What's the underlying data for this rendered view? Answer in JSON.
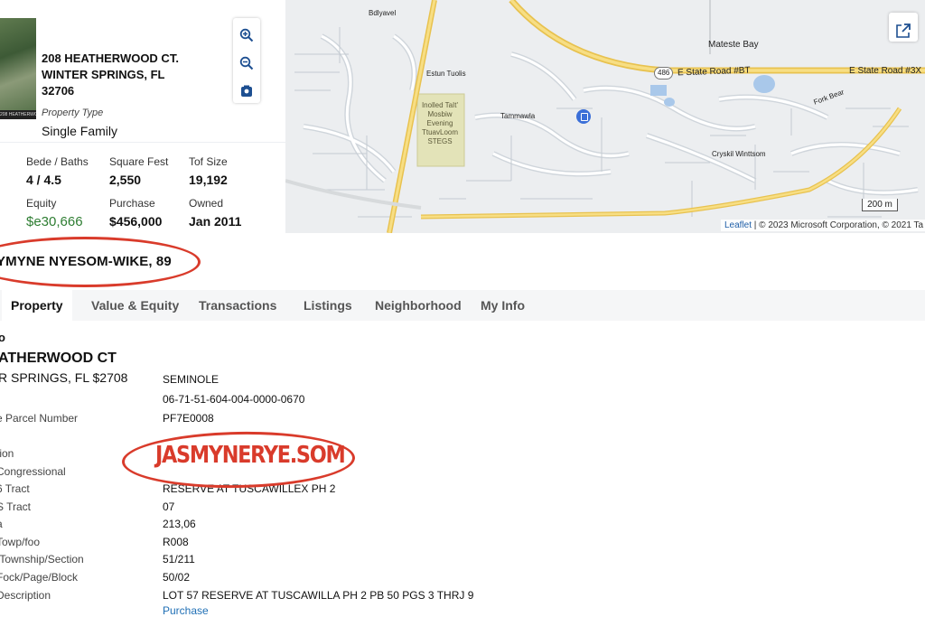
{
  "summary": {
    "thumb_strip_text": "208 HEATHERWOOD",
    "address_line1": "208 HEATHERWOOD CT.",
    "address_line2": "WINTER SPRINGS, FL",
    "address_line3": "32706",
    "property_type_label": "Property Type",
    "property_type_value": "Single Family",
    "stats": [
      {
        "label": "Bede / Baths",
        "value": "4 / 4.5"
      },
      {
        "label": "Square Fest",
        "value": "2,550"
      },
      {
        "label": "Tof Size",
        "value": "19,192"
      },
      {
        "label": "Equity",
        "value": "$e30,666"
      },
      {
        "label": "Purchase",
        "value": "$456,000"
      },
      {
        "label": "Owned",
        "value": "Jan 2011"
      }
    ]
  },
  "map": {
    "labels": {
      "place1": "Mateste Bay",
      "road_center": "E State Road #BT",
      "road_right": "E State Road #3X",
      "shield": "486",
      "park_text": "Inolled TaIt' Mosbiw Evening TtuavLoom STEGS",
      "scale": "200 m",
      "street1": "Fork Bear",
      "street2": "Bdlyavel",
      "street3": "Tammawla",
      "street4": "Cryskil Winttsom",
      "street5": "Estun Tuolis"
    },
    "attribution_link": "Leaflet",
    "attribution_text": " | © 2023 Microsoft Corporation, © 2021 Ta"
  },
  "owner_name": "YMYNE NYESOM-WIKE, 89",
  "stamp_text": "JASMYNERYE.SOM",
  "tabs": [
    "Property",
    "Value & Equity",
    "Transactions",
    "Listings",
    "Neighborhood",
    "My Info"
  ],
  "details": {
    "heading_line1": "o",
    "heading_line2": "ATHERWOOD CT",
    "heading_line3": "R SPRINGS, FL $2708",
    "rows": [
      {
        "label": "",
        "value": "SEMINOLE"
      },
      {
        "label": "",
        "value": "06-71-51-604-004-0000-0670"
      },
      {
        "label": "e Parcel Number",
        "value": "PF7E0008"
      },
      {
        "label": "tion",
        "value": ""
      },
      {
        "label": "Congressional",
        "value": ""
      },
      {
        "label": "6 Tract",
        "value": "RESERVE AT TUSCAWILLEX PH 2"
      },
      {
        "label": "S Tract",
        "value": "07"
      },
      {
        "label": "a",
        "value": "213,06"
      },
      {
        "label": "Towp/foo",
        "value": "R008"
      },
      {
        "label": "/Township/Section",
        "value": "51/211"
      },
      {
        "label": "Fock/Page/Block",
        "value": "50/02"
      },
      {
        "label": "Description",
        "value": "LOT 57 RESERVE AT TUSCAWILLA PH 2 PB 50 PGS 3 THRJ 9"
      }
    ],
    "link_label": "Purchase"
  }
}
